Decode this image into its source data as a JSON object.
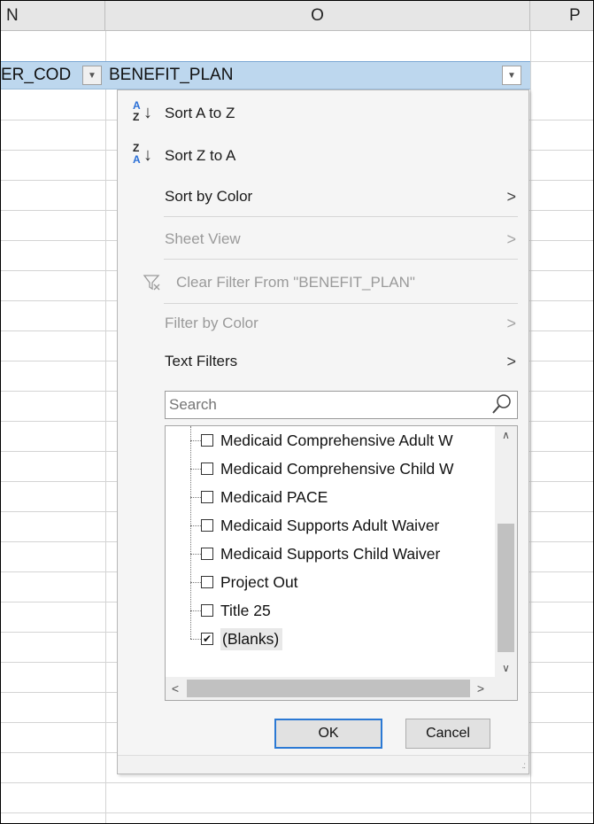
{
  "columns": {
    "n": "N",
    "o": "O",
    "p": "P"
  },
  "header_row": {
    "n_cell": "ER_COD",
    "o_cell": "BENEFIT_PLAN"
  },
  "menu": {
    "sort_az": {
      "label": "Sort A to Z",
      "icon_top": "A",
      "icon_bottom": "Z"
    },
    "sort_za": {
      "label": "Sort Z to A",
      "icon_top": "Z",
      "icon_bottom": "A"
    },
    "sort_by_color": "Sort by Color",
    "sheet_view": "Sheet View",
    "clear_filter": "Clear Filter From \"BENEFIT_PLAN\"",
    "filter_by_color": "Filter by Color",
    "text_filters": "Text Filters",
    "search_placeholder": "Search",
    "list_items": [
      {
        "label": "Medicaid Comprehensive Adult W",
        "checked": false
      },
      {
        "label": "Medicaid Comprehensive Child W",
        "checked": false
      },
      {
        "label": "Medicaid PACE",
        "checked": false
      },
      {
        "label": "Medicaid Supports Adult Waiver",
        "checked": false
      },
      {
        "label": "Medicaid Supports Child Waiver",
        "checked": false
      },
      {
        "label": "Project Out",
        "checked": false
      },
      {
        "label": "Title 25",
        "checked": false
      },
      {
        "label": "(Blanks)",
        "checked": true
      }
    ],
    "ok_label": "OK",
    "cancel_label": "Cancel"
  },
  "icons": {
    "submenu_arrow": "chevron-right-icon",
    "filter_button": "dropdown-arrow-icon",
    "search": "magnifier-icon",
    "clear_filter": "filter-clear-icon"
  }
}
